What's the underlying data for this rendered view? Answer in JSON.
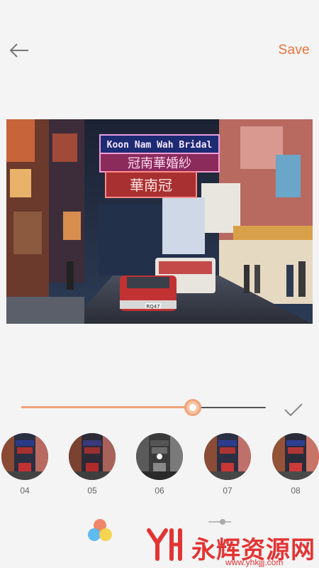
{
  "header": {
    "back_icon": "arrow-left-icon",
    "save_label": "Save",
    "accent_color": "#e8733a"
  },
  "photo": {
    "sign_top_text": "Koon Nam Wah Bridal",
    "sign_chinese_1": "冠南華婚紗",
    "sign_chinese_2": "華南冠",
    "taxi_plate": "RQ47"
  },
  "slider": {
    "value_fraction": 0.7,
    "confirm_icon": "checkmark-icon"
  },
  "filters": [
    {
      "label": "04"
    },
    {
      "label": "05"
    },
    {
      "label": "06"
    },
    {
      "label": "07"
    },
    {
      "label": "08"
    }
  ],
  "bottom": {
    "palette_icon": "color-palette-icon",
    "adjust_icon": "adjust-slider-icon"
  },
  "watermark": {
    "text": "永辉资源网",
    "url": "www.yhkjjj.com"
  }
}
